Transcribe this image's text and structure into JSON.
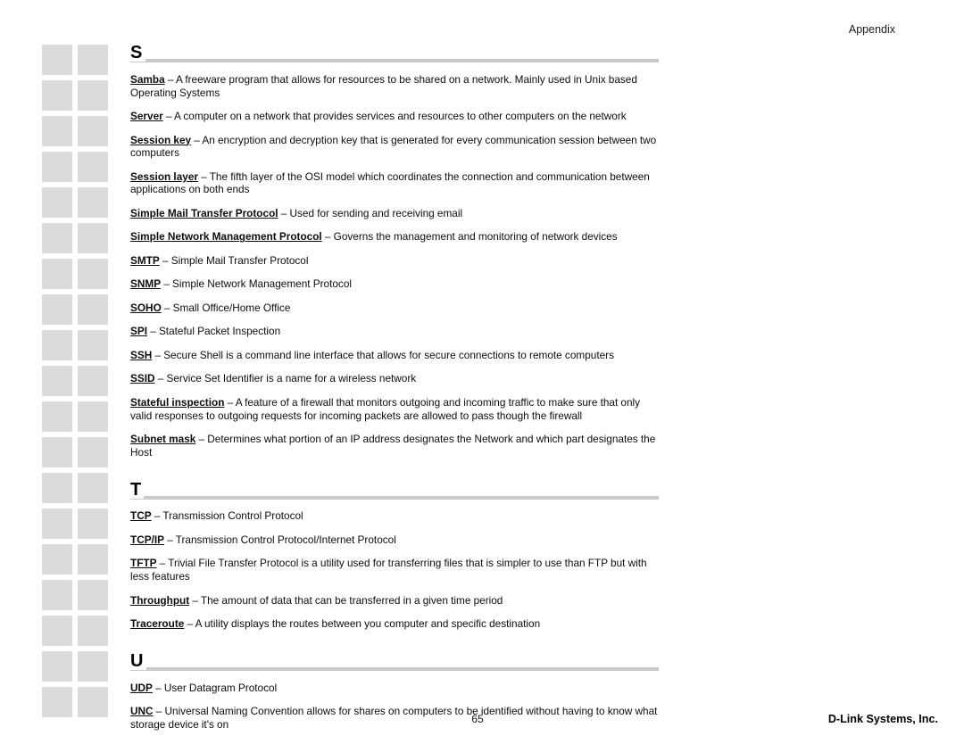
{
  "header": {
    "title": "Appendix"
  },
  "footer": {
    "page_number": "65",
    "company": "D-Link Systems, Inc."
  },
  "thumbnail_rail": {
    "columns": 2,
    "rows": 19,
    "cell_color": "#dedbdb"
  },
  "theme": {
    "rule_color": "#c9c9c9",
    "text_color": "#0d0d0d",
    "page_background": "#ffffff"
  },
  "glossary": {
    "separator": " – ",
    "sections": [
      {
        "letter": "S",
        "entries": [
          {
            "term": "Samba",
            "definition": "A freeware program that allows for resources to be shared on a network.  Mainly used in Unix based Operating Systems"
          },
          {
            "term": "Server",
            "definition": "A computer on a network that provides services and resources to other computers on the network"
          },
          {
            "term": "Session key",
            "definition": "An encryption and decryption key that is generated for every communication session between two computers"
          },
          {
            "term": "Session layer",
            "definition": "The fifth layer of the OSI model which coordinates the connection and communication between applications on both ends"
          },
          {
            "term": "Simple Mail Transfer Protocol",
            "definition": "Used for sending and receiving email"
          },
          {
            "term": "Simple Network Management Protocol",
            "definition": "Governs the management and monitoring of network devices"
          },
          {
            "term": "SMTP",
            "definition": "Simple Mail Transfer Protocol"
          },
          {
            "term": "SNMP",
            "definition": "Simple Network Management Protocol"
          },
          {
            "term": "SOHO",
            "definition": "Small Office/Home Office"
          },
          {
            "term": "SPI",
            "definition": "Stateful Packet Inspection"
          },
          {
            "term": "SSH",
            "definition": "Secure Shell is a command line interface that allows for secure connections to remote computers"
          },
          {
            "term": "SSID",
            "definition": "Service Set Identifier is a name for a wireless network"
          },
          {
            "term": "Stateful inspection",
            "definition": "A feature of a firewall that monitors outgoing and incoming traffic to make sure that only valid responses to outgoing requests for incoming packets are allowed to pass though the firewall"
          },
          {
            "term": "Subnet mask",
            "definition": "Determines what portion of an IP address designates the Network and which part designates the Host"
          }
        ]
      },
      {
        "letter": "T",
        "entries": [
          {
            "term": "TCP",
            "definition": "Transmission Control Protocol"
          },
          {
            "term": "TCP/IP",
            "definition": "Transmission Control Protocol/Internet Protocol"
          },
          {
            "term": "TFTP",
            "definition": "Trivial File Transfer Protocol is a utility used for transferring files that is simpler to use than FTP but with less features"
          },
          {
            "term": "Throughput",
            "definition": "The amount of data that can be transferred in a given time period"
          },
          {
            "term": "Traceroute",
            "definition": "A utility displays the routes between you computer and specific destination"
          }
        ]
      },
      {
        "letter": "U",
        "entries": [
          {
            "term": "UDP",
            "definition": "User Datagram Protocol"
          },
          {
            "term": "UNC",
            "definition": "Universal Naming Convention allows for shares on computers to be identified without having to know what storage device it's on"
          }
        ]
      }
    ]
  }
}
